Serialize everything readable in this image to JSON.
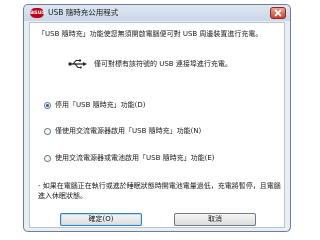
{
  "window": {
    "title": "USB 隨時充公用程式",
    "app_icon_text": "asus"
  },
  "intro": {
    "text": "「USB 隨時充」功能使您無須開啟電腦便可對 USB 周邊裝置進行充電。"
  },
  "usb_note": {
    "text": "僅可對標有該符號的 USB 連接埠進行充電。"
  },
  "options": [
    {
      "label": "停用「USB 隨時充」功能(D)",
      "checked": true
    },
    {
      "label": "僅使用交流電源器啟用「USB 隨時充」功能(N)",
      "checked": false
    },
    {
      "label": "使用交流電源器或電池啟用「USB 隨時充」功能(E)",
      "checked": false
    }
  ],
  "footnote": {
    "text": "- 如果在電腦正在執行或進於睡眠狀態時開電池電量過低，充電將暫停，且電腦進入休眠狀態。"
  },
  "buttons": {
    "ok": "確定(O)",
    "cancel": "取消"
  }
}
